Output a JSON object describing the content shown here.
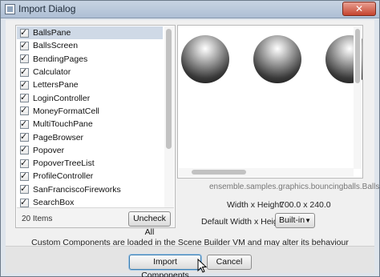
{
  "window": {
    "title": "Import Dialog",
    "close_label": "✕"
  },
  "list": {
    "items": [
      {
        "label": "BallsPane",
        "checked": true,
        "selected": true
      },
      {
        "label": "BallsScreen",
        "checked": true
      },
      {
        "label": "BendingPages",
        "checked": true
      },
      {
        "label": "Calculator",
        "checked": true
      },
      {
        "label": "LettersPane",
        "checked": true
      },
      {
        "label": "LoginController",
        "checked": true
      },
      {
        "label": "MoneyFormatCell",
        "checked": true
      },
      {
        "label": "MultiTouchPane",
        "checked": true
      },
      {
        "label": "PageBrowser",
        "checked": true
      },
      {
        "label": "Popover",
        "checked": true
      },
      {
        "label": "PopoverTreeList",
        "checked": true
      },
      {
        "label": "ProfileController",
        "checked": true
      },
      {
        "label": "SanFranciscoFireworks",
        "checked": true
      },
      {
        "label": "SearchBox",
        "checked": true
      }
    ],
    "count_text": "20 Items",
    "uncheck_all_label": "Uncheck All"
  },
  "preview": {
    "class_name": "ensemble.samples.graphics.bouncingballs.BallsPane",
    "dims_label": "Width x Height:",
    "dims_value": "700.0 x 240.0",
    "default_label": "Default Width x Height:",
    "default_value": "Built-in"
  },
  "info_text": "Custom Components are loaded in the Scene Builder VM and may alter its behaviour",
  "buttons": {
    "import_label": "Import Components",
    "cancel_label": "Cancel"
  }
}
